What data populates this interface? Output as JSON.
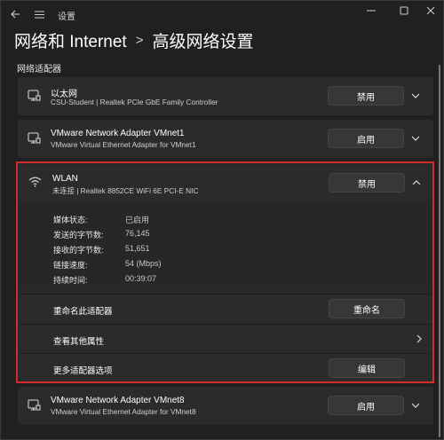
{
  "window": {
    "title": "设置",
    "back_icon": "back-arrow-icon",
    "menu_icon": "hamburger-menu-icon",
    "controls": [
      "minimize-icon",
      "maximize-icon",
      "close-icon"
    ]
  },
  "breadcrumb": {
    "parent": "网络和 Internet",
    "separator": ">",
    "current": "高级网络设置"
  },
  "section_title": "网络适配器",
  "adapters": [
    {
      "name": "以太网",
      "desc": "CSU-Student | Realtek PCIe GbE Family Controller",
      "button": "禁用",
      "icon": "ethernet-monitor-icon"
    },
    {
      "name": "VMware Network Adapter VMnet1",
      "desc": "VMware Virtual Ethernet Adapter for VMnet1",
      "button": "启用",
      "icon": "ethernet-monitor-icon"
    },
    {
      "name": "VMware Network Adapter VMnet8",
      "desc": "VMware Virtual Ethernet Adapter for VMnet8",
      "button": "启用",
      "icon": "ethernet-monitor-icon"
    }
  ],
  "wlan": {
    "name": "WLAN",
    "desc": "未连接 | Realtek 8852CE WiFi 6E PCI-E NIC",
    "button": "禁用",
    "icon": "wifi-icon",
    "stats": [
      {
        "label": "媒体状态:",
        "value": "已启用"
      },
      {
        "label": "发送的字节数:",
        "value": "76,145"
      },
      {
        "label": "接收的字节数:",
        "value": "51,651"
      },
      {
        "label": "链接速度:",
        "value": "54 (Mbps)"
      },
      {
        "label": "持续时间:",
        "value": "00:39:07"
      }
    ],
    "rename_label": "重命名此适配器",
    "rename_button": "重命名",
    "more_props_label": "查看其他属性",
    "more_options_label": "更多适配器选项",
    "edit_button": "编辑"
  },
  "colors": {
    "highlight_border": "#d42a2a",
    "card_bg": "#2b2b2b",
    "window_bg": "#202020"
  }
}
